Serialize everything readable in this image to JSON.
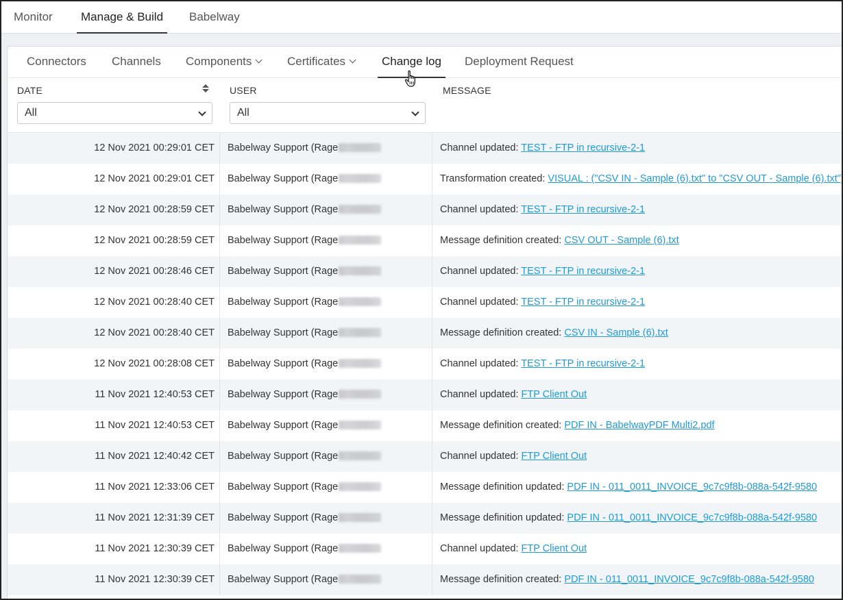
{
  "topnav": {
    "tabs": [
      {
        "label": "Monitor"
      },
      {
        "label": "Manage & Build"
      },
      {
        "label": "Babelway"
      }
    ],
    "active": "Manage & Build"
  },
  "subnav": {
    "tabs": [
      {
        "label": "Connectors"
      },
      {
        "label": "Channels"
      },
      {
        "label": "Components"
      },
      {
        "label": "Certificates"
      },
      {
        "label": "Change log"
      },
      {
        "label": "Deployment Request"
      }
    ],
    "active": "Change log"
  },
  "table": {
    "columns": {
      "date": "DATE",
      "user": "USER",
      "message": "MESSAGE"
    },
    "filters": {
      "date": "All",
      "user": "All"
    },
    "rows": [
      {
        "date": "12 Nov 2021 00:29:01 CET",
        "user": "Babelway Support (Rage",
        "prefix": "Channel updated:",
        "link": "TEST - FTP in recursive-2-1"
      },
      {
        "date": "12 Nov 2021 00:29:01 CET",
        "user": "Babelway Support (Rage",
        "prefix": "Transformation created:",
        "link": "VISUAL : (\"CSV IN - Sample (6).txt\" to \"CSV OUT - Sample (6).txt\")"
      },
      {
        "date": "12 Nov 2021 00:28:59 CET",
        "user": "Babelway Support (Rage",
        "prefix": "Channel updated:",
        "link": "TEST - FTP in recursive-2-1"
      },
      {
        "date": "12 Nov 2021 00:28:59 CET",
        "user": "Babelway Support (Rage",
        "prefix": "Message definition created:",
        "link": "CSV OUT - Sample (6).txt"
      },
      {
        "date": "12 Nov 2021 00:28:46 CET",
        "user": "Babelway Support (Rage",
        "prefix": "Channel updated:",
        "link": "TEST - FTP in recursive-2-1"
      },
      {
        "date": "12 Nov 2021 00:28:40 CET",
        "user": "Babelway Support (Rage",
        "prefix": "Channel updated:",
        "link": "TEST - FTP in recursive-2-1"
      },
      {
        "date": "12 Nov 2021 00:28:40 CET",
        "user": "Babelway Support (Rage",
        "prefix": "Message definition created:",
        "link": "CSV IN - Sample (6).txt"
      },
      {
        "date": "12 Nov 2021 00:28:08 CET",
        "user": "Babelway Support (Rage",
        "prefix": "Channel updated:",
        "link": "TEST - FTP in recursive-2-1"
      },
      {
        "date": "11 Nov 2021 12:40:53 CET",
        "user": "Babelway Support (Rage",
        "prefix": "Channel updated:",
        "link": "FTP Client Out"
      },
      {
        "date": "11 Nov 2021 12:40:53 CET",
        "user": "Babelway Support (Rage",
        "prefix": "Message definition created:",
        "link": "PDF IN - BabelwayPDF Multi2.pdf"
      },
      {
        "date": "11 Nov 2021 12:40:42 CET",
        "user": "Babelway Support (Rage",
        "prefix": "Channel updated:",
        "link": "FTP Client Out"
      },
      {
        "date": "11 Nov 2021 12:33:06 CET",
        "user": "Babelway Support (Rage",
        "prefix": "Message definition updated:",
        "link": "PDF IN - 011_0011_INVOICE_9c7c9f8b-088a-542f-9580"
      },
      {
        "date": "11 Nov 2021 12:31:39 CET",
        "user": "Babelway Support (Rage",
        "prefix": "Message definition updated:",
        "link": "PDF IN - 011_0011_INVOICE_9c7c9f8b-088a-542f-9580"
      },
      {
        "date": "11 Nov 2021 12:30:39 CET",
        "user": "Babelway Support (Rage",
        "prefix": "Channel updated:",
        "link": "FTP Client Out"
      },
      {
        "date": "11 Nov 2021 12:30:39 CET",
        "user": "Babelway Support (Rage",
        "prefix": "Message definition created:",
        "link": "PDF IN - 011_0011_INVOICE_9c7c9f8b-088a-542f-9580"
      }
    ]
  },
  "colors": {
    "link": "#1e9bd7",
    "row_stripe": "#f1f5f7",
    "content_bg": "#eef0f2"
  }
}
